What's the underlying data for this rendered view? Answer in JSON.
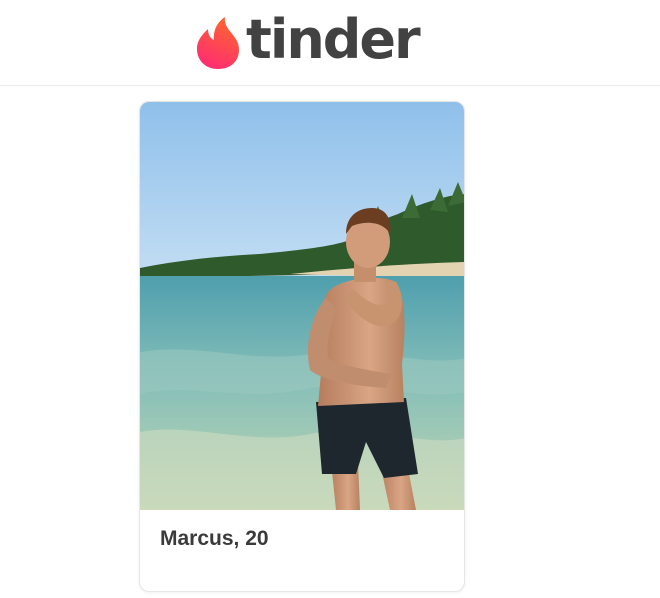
{
  "brand": {
    "name": "tinder",
    "accent_from": "#fd267a",
    "accent_to": "#ff6036",
    "logo_icon": "flame-icon"
  },
  "profile": {
    "name_age": "Marcus, 20",
    "photo_description_icon": "profile-photo"
  }
}
